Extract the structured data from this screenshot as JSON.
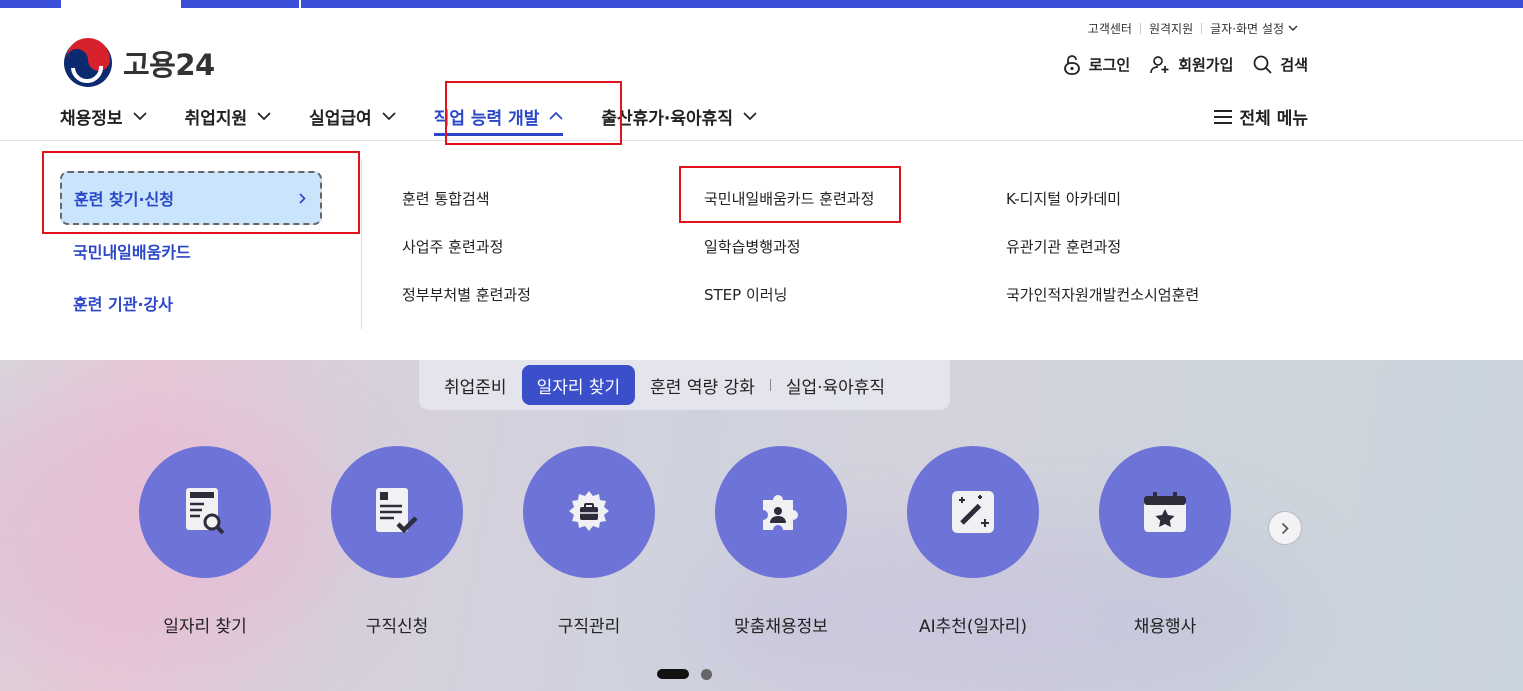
{
  "utility": {
    "customer_center": "고객센터",
    "remote_support": "원격지원",
    "display_settings": "글자·화면 설정"
  },
  "logo": {
    "text": "고용24"
  },
  "account": {
    "login": "로그인",
    "signup": "회원가입",
    "search": "검색"
  },
  "gnb": {
    "items": [
      {
        "label": "채용정보"
      },
      {
        "label": "취업지원"
      },
      {
        "label": "실업급여"
      },
      {
        "label": "직업 능력 개발"
      },
      {
        "label": "출산휴가·육아휴직"
      }
    ],
    "all_menu": "전체 메뉴"
  },
  "mega_menu": {
    "side": [
      "훈련 찾기·신청",
      "국민내일배움카드",
      "훈련 기관·강사"
    ],
    "columns": [
      [
        "훈련 통합검색",
        "사업주 훈련과정",
        "정부부처별 훈련과정"
      ],
      [
        "국민내일배움카드 훈련과정",
        "일학습병행과정",
        "STEP 이러닝"
      ],
      [
        "K-디지털 아카데미",
        "유관기관 훈련과정",
        "국가인적자원개발컨소시엄훈련"
      ]
    ]
  },
  "hero": {
    "tabs": [
      "취업준비",
      "일자리 찾기",
      "훈련 역량 강화",
      "실업·육아휴직"
    ],
    "services": [
      {
        "label": "일자리 찾기",
        "icon": "document-search-icon"
      },
      {
        "label": "구직신청",
        "icon": "document-check-icon"
      },
      {
        "label": "구직관리",
        "icon": "gear-briefcase-icon"
      },
      {
        "label": "맞춤채용정보",
        "icon": "puzzle-person-icon"
      },
      {
        "label": "AI추천(일자리)",
        "icon": "magic-wand-icon"
      },
      {
        "label": "채용행사",
        "icon": "calendar-star-icon"
      }
    ]
  },
  "colors": {
    "accent": "#2a47c9",
    "service_circle": "#6e73d8",
    "annotation": "#e0121b"
  }
}
